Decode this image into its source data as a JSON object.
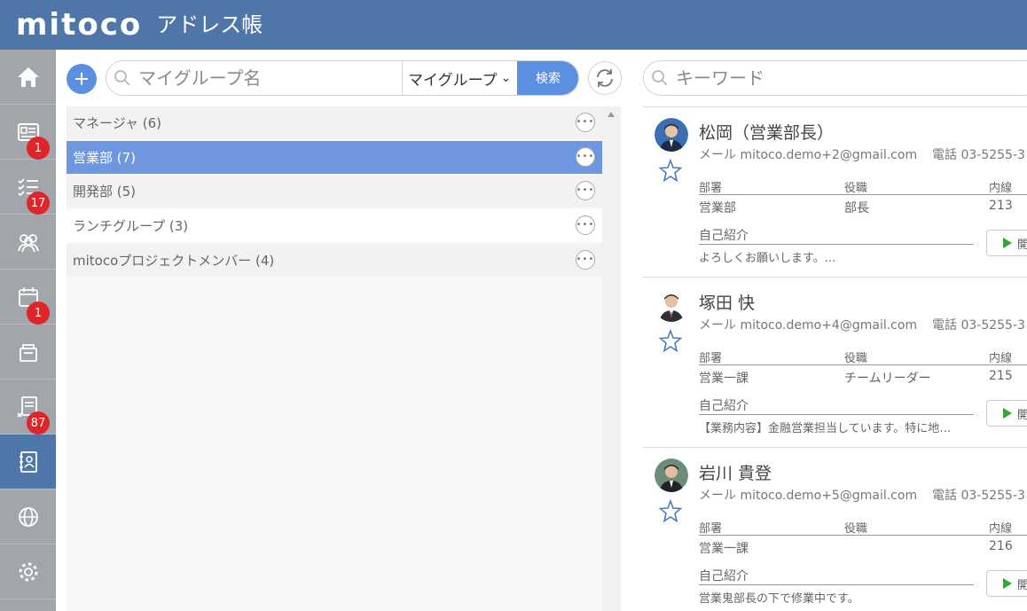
{
  "header": {
    "logo": "mitoco",
    "title": "アドレス帳"
  },
  "sidebar": {
    "items": [
      {
        "icon": "home-icon",
        "badge": null
      },
      {
        "icon": "news-icon",
        "badge": "1"
      },
      {
        "icon": "todo-icon",
        "badge": "17"
      },
      {
        "icon": "group-icon",
        "badge": null
      },
      {
        "icon": "calendar-icon",
        "badge": "1"
      },
      {
        "icon": "folder-icon",
        "badge": null
      },
      {
        "icon": "approval-icon",
        "badge": "87"
      },
      {
        "icon": "address-book-icon",
        "badge": null,
        "active": true
      },
      {
        "icon": "globe-icon",
        "badge": null
      },
      {
        "icon": "gear-icon",
        "badge": null
      }
    ]
  },
  "group_search": {
    "placeholder": "マイグループ名",
    "select_value": "マイグループ",
    "search_label": "検索"
  },
  "groups": [
    {
      "label": "マネージャ (6)"
    },
    {
      "label": "営業部 (7)",
      "selected": true
    },
    {
      "label": "開発部 (5)"
    },
    {
      "label": "ランチグループ (3)"
    },
    {
      "label": "mitocoプロジェクトメンバー (4)"
    }
  ],
  "keyword_search": {
    "placeholder": "キーワード"
  },
  "labels": {
    "mail": "メール",
    "tel": "電話",
    "dept": "部署",
    "position": "役職",
    "ext": "内線",
    "intro": "自己紹介",
    "open": "開"
  },
  "contacts": [
    {
      "name": "松岡（営業部長）",
      "email": "mitoco.demo+2@gmail.com",
      "tel": "03-5255-3",
      "dept": "営業部",
      "position": "部長",
      "ext": "213",
      "intro": "よろしくお願いします。..."
    },
    {
      "name": "塚田 快",
      "email": "mitoco.demo+4@gmail.com",
      "tel": "03-5255-3",
      "dept": "営業一課",
      "position": "チームリーダー",
      "ext": "215",
      "intro": "【業務内容】金融営業担当しています。特に地…"
    },
    {
      "name": "岩川 貴登",
      "email": "mitoco.demo+5@gmail.com",
      "tel": "03-5255-3",
      "dept": "営業一課",
      "position": "",
      "ext": "216",
      "intro": "営業鬼部長の下で修業中です。"
    }
  ],
  "colors": {
    "header": "#4e76a8",
    "sidebar": "#a2a6aa",
    "accent": "#5b8fe0",
    "selected_row": "#6e97e0",
    "badge": "#e0252a"
  }
}
